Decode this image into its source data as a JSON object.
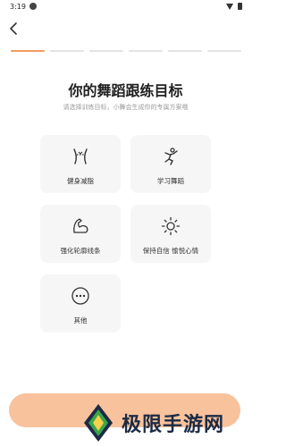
{
  "status_bar": {
    "time": "3:19"
  },
  "progress": {
    "total_steps": 6,
    "current_step": 1
  },
  "header": {
    "title": "你的舞蹈跟练目标",
    "subtitle": "请选择训练目标，小舞会生成你的专属方案哦"
  },
  "options": [
    {
      "label": "健身减脂",
      "icon": "waist-icon"
    },
    {
      "label": "学习舞蹈",
      "icon": "dance-icon"
    },
    {
      "label": "强化轮廓线条",
      "icon": "muscle-icon"
    },
    {
      "label": "保持自信 愉悦心情",
      "icon": "sun-icon"
    },
    {
      "label": "其他",
      "icon": "more-icon"
    }
  ],
  "watermark": {
    "text": "极限手游网"
  },
  "colors": {
    "accent": "#f39b60",
    "button": "#f8c29c",
    "card": "#f6f6f6"
  }
}
